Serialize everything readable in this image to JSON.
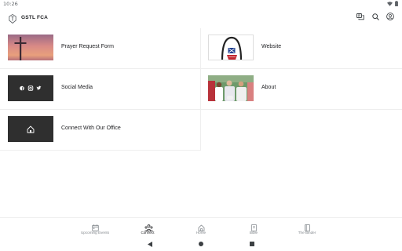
{
  "status_bar": {
    "time": "10:26",
    "icons": [
      "wifi-icon",
      "battery-icon"
    ]
  },
  "app_bar": {
    "title": "GSTL FCA",
    "logo_icon": "fca-logo-icon",
    "actions": [
      "chat-icon",
      "search-icon",
      "account-icon"
    ]
  },
  "cards": [
    {
      "label": "Prayer Request Form",
      "image": "cross-sunset-image"
    },
    {
      "label": "Website",
      "image": "arch-logo-image"
    },
    {
      "label": "Social Media",
      "image": "social-icons-image"
    },
    {
      "label": "About",
      "image": "athletes-photo-image"
    },
    {
      "label": "Connect With Our Office",
      "image": "home-icon-image"
    }
  ],
  "bottom_nav": {
    "items": [
      {
        "label": "Upcoming Events",
        "icon": "calendar-icon",
        "active": false
      },
      {
        "label": "Connect",
        "icon": "people-icon",
        "active": true
      },
      {
        "label": "Home",
        "icon": "home-icon",
        "active": false
      },
      {
        "label": "Bible",
        "icon": "bible-icon",
        "active": false
      },
      {
        "label": "The Binder",
        "icon": "binder-icon",
        "active": false
      }
    ]
  },
  "system_nav": [
    "back-icon",
    "home-circle-icon",
    "recents-icon"
  ],
  "colors": {
    "text": "#202124",
    "muted": "#80868b",
    "divider": "#eeeeee",
    "dark_tile": "#2f2f2f"
  }
}
